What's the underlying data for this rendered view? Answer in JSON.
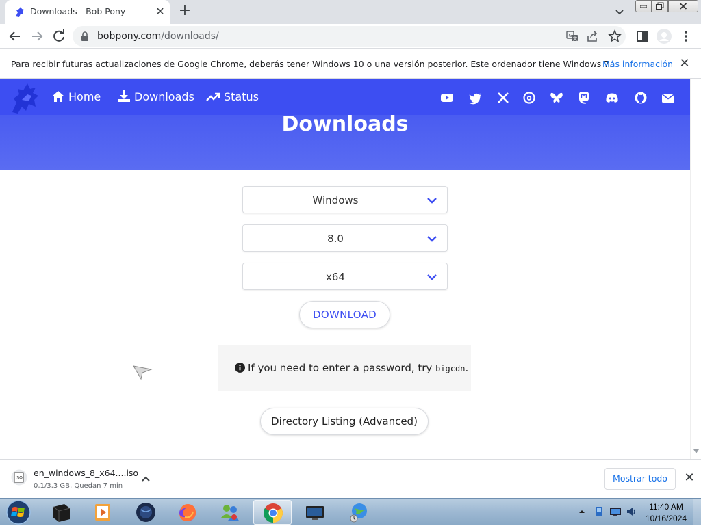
{
  "browser": {
    "tab_title": "Downloads - Bob Pony",
    "url_host": "bobpony.com",
    "url_path": "/downloads/"
  },
  "infobar": {
    "message": "Para recibir futuras actualizaciones de Google Chrome, deberás tener Windows 10 o una versión posterior. Este ordenador tiene Windows 7.",
    "link": "Más información"
  },
  "site": {
    "nav": [
      {
        "label": "Home",
        "icon": "home-icon"
      },
      {
        "label": "Downloads",
        "icon": "download-icon"
      },
      {
        "label": "Status",
        "icon": "trend-icon"
      }
    ],
    "social_icons": [
      "youtube-icon",
      "twitter-icon",
      "x-icon",
      "threads-icon",
      "bluesky-icon",
      "mastodon-icon",
      "discord-icon",
      "github-icon",
      "email-icon"
    ],
    "accent_color": "#3d4ef2"
  },
  "page": {
    "heading": "Downloads",
    "select_os": "Windows",
    "select_version": "8.0",
    "select_arch": "x64",
    "download_label": "DOWNLOAD",
    "notice_text": "If you need to enter a password, try ",
    "notice_code": "bigcdn",
    "notice_end": ".",
    "dirlist_label": "Directory Listing (Advanced)"
  },
  "shelf": {
    "filename": "en_windows_8_x64....iso",
    "status": "0,1/3,3 GB, Quedan 7 min",
    "show_all": "Mostrar todo"
  },
  "taskbar": {
    "time": "11:40 AM",
    "date": "10/16/2024",
    "apps": [
      "terminal-icon",
      "media-player-icon",
      "globe-dark-icon",
      "firefox-icon",
      "users-icon",
      "chrome-icon",
      "monitor-icon",
      "network-globe-icon"
    ]
  }
}
